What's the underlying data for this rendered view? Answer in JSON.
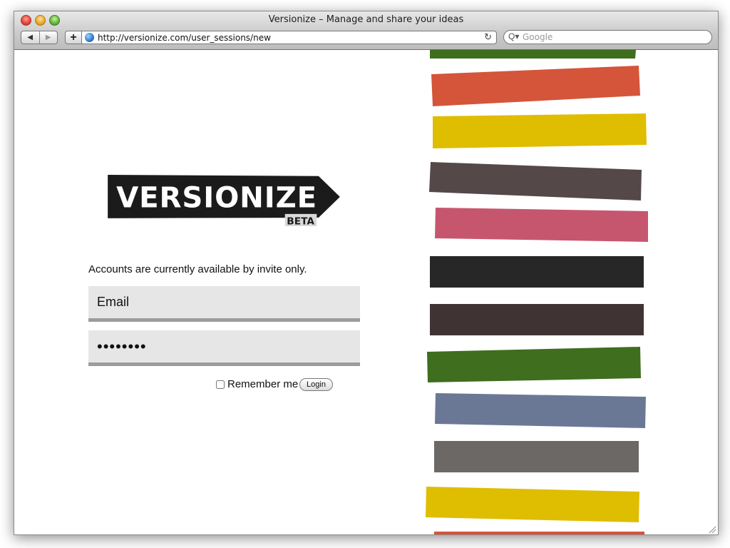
{
  "window": {
    "title": "Versionize – Manage and share your ideas"
  },
  "toolbar": {
    "back_icon": "◀",
    "forward_icon": "▶",
    "add_icon": "+",
    "url": "http://versionize.com/user_sessions/new",
    "reload_icon": "↻",
    "search_icon": "Q▾",
    "search_placeholder": "Google"
  },
  "page": {
    "logo_text": "VERSIONIZE",
    "logo_badge": "BETA",
    "notice": "Accounts are currently available by invite only.",
    "email_placeholder": "Email",
    "password_value": "••••••••",
    "remember_label": "Remember me",
    "login_label": "Login",
    "stripe_colors": [
      "#3e6e1e",
      "#d4553a",
      "#dfbd00",
      "#554848",
      "#c6566e",
      "#272727",
      "#403333",
      "#3e6e1e",
      "#6a7896",
      "#6b6866",
      "#dfbd00",
      "#d4553a"
    ]
  }
}
